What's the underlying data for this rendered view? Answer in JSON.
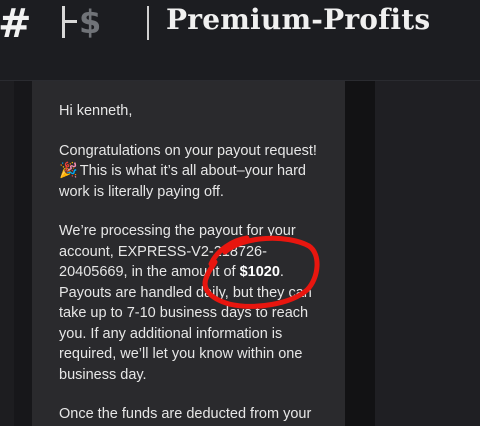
{
  "header": {
    "hash_glyph": "#",
    "logo_dollar": "$",
    "brand_name": "Premium-Profits"
  },
  "email": {
    "greeting": "Hi kenneth,",
    "para1_text": "Congratulations on your payout request!",
    "para1_emoji": "🎉",
    "para1_rest": "This is what it’s all about–your hard work is literally paying off.",
    "para2_before": "We’re processing the payout for your account, EXPRESS-V2-218726-20405669, in the amount of",
    "amount": "$1020",
    "para2_after": ". Payouts are handled daily, but they can take up to 7-10 business days to reach you. If any additional information is required, we’ll let you know within one business day.",
    "para3_text": "Once the funds are deducted from your"
  },
  "annotation": {
    "color": "#e8160f",
    "shape": "hand-drawn circle around amount"
  }
}
